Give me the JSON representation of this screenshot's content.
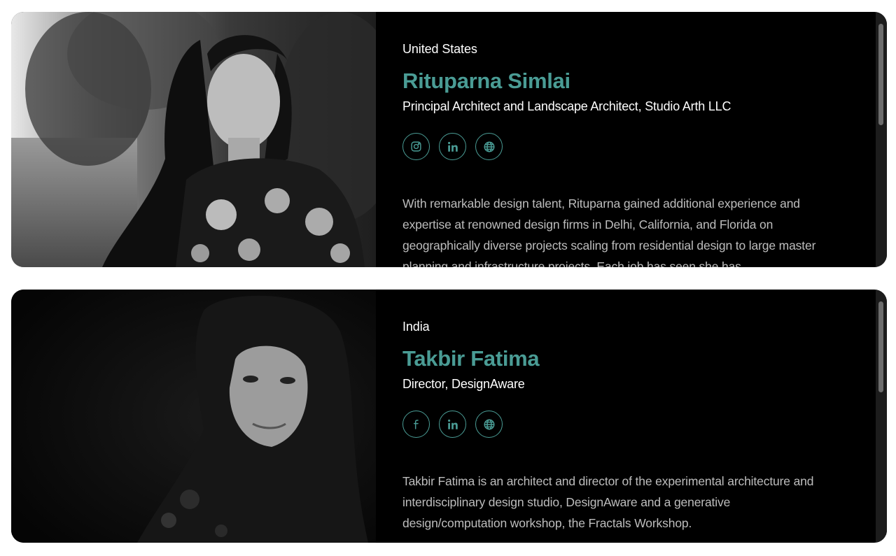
{
  "people": [
    {
      "country": "United States",
      "name": "Rituparna Simlai",
      "role": "Principal Architect and Landscape Architect, Studio Arth LLC",
      "socials": [
        {
          "icon": "instagram-icon",
          "label": "Instagram"
        },
        {
          "icon": "linkedin-icon",
          "label": "LinkedIn"
        },
        {
          "icon": "globe-icon",
          "label": "Website"
        }
      ],
      "bio": "With remarkable design talent, Rituparna gained additional experience and expertise at renowned design firms in Delhi, California, and Florida on geographically diverse projects scaling from residential design to large master planning and infrastructure projects. Each job has seen she has"
    },
    {
      "country": "India",
      "name": "Takbir Fatima",
      "role": "Director, DesignAware",
      "socials": [
        {
          "icon": "facebook-icon",
          "label": "Facebook"
        },
        {
          "icon": "linkedin-icon",
          "label": "LinkedIn"
        },
        {
          "icon": "globe-icon",
          "label": "Website"
        }
      ],
      "bio": "Takbir Fatima is an architect and director of the experimental architecture and interdisciplinary design studio, DesignAware and a generative design/computation workshop, the Fractals Workshop."
    }
  ],
  "colors": {
    "accent": "#4a9c95",
    "card_bg": "#000000",
    "bio_text": "#bdbdbd"
  }
}
